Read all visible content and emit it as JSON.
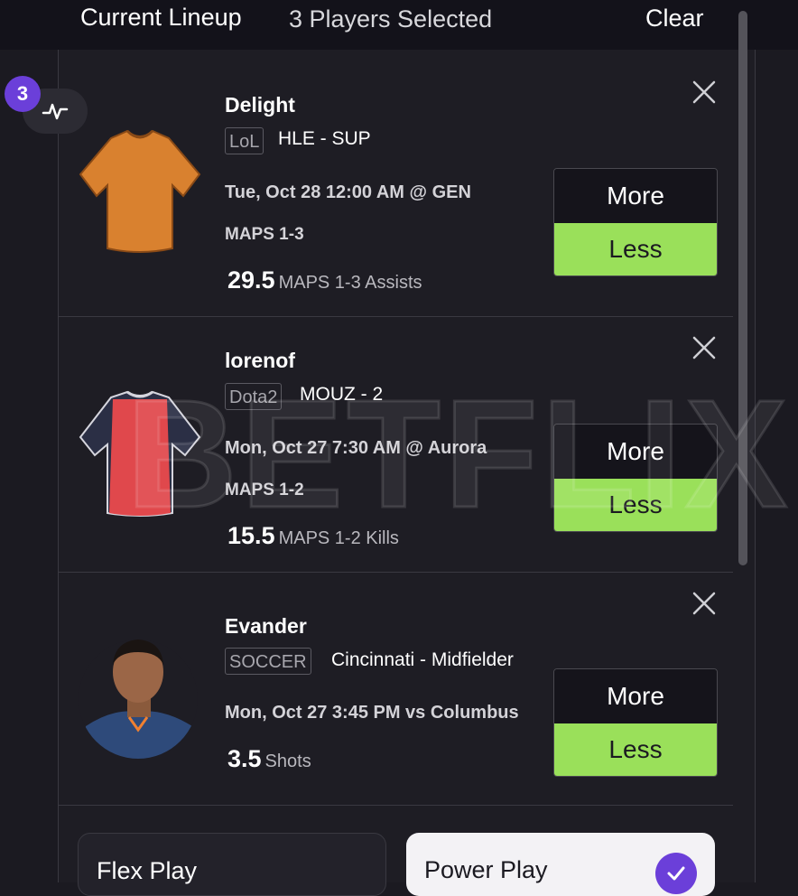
{
  "header": {
    "title": "Current Lineup",
    "subtitle": "3 Players Selected",
    "clear_label": "Clear"
  },
  "badge": {
    "count": "3"
  },
  "watermark": "BETFLIX",
  "players": [
    {
      "name": "Delight",
      "sport": "LoL",
      "team": "HLE - SUP",
      "game": "Tue, Oct 28 12:00 AM @ GEN",
      "maps": "MAPS 1-3",
      "line_value": "29.5",
      "line_stat": "MAPS 1-3 Assists",
      "more_label": "More",
      "less_label": "Less",
      "avatar": "orange-jersey-icon"
    },
    {
      "name": "lorenof",
      "sport": "Dota2",
      "team": "MOUZ - 2",
      "game": "Mon, Oct 27 7:30 AM @ Aurora",
      "maps": "MAPS 1-2",
      "line_value": "15.5",
      "line_stat": "MAPS 1-2 Kills",
      "more_label": "More",
      "less_label": "Less",
      "avatar": "red-jersey-icon"
    },
    {
      "name": "Evander",
      "sport": "SOCCER",
      "team": "Cincinnati - Midfielder",
      "game": "Mon, Oct 27 3:45 PM vs Columbus",
      "line_value": "3.5",
      "line_stat": "Shots",
      "more_label": "More",
      "less_label": "Less",
      "avatar": "player-headshot"
    }
  ],
  "play_options": {
    "flex": "Flex Play",
    "power": "Power Play"
  },
  "colors": {
    "accent_purple": "#6b3fd9",
    "less_green": "#9ae05a",
    "background": "#1e1d24"
  }
}
